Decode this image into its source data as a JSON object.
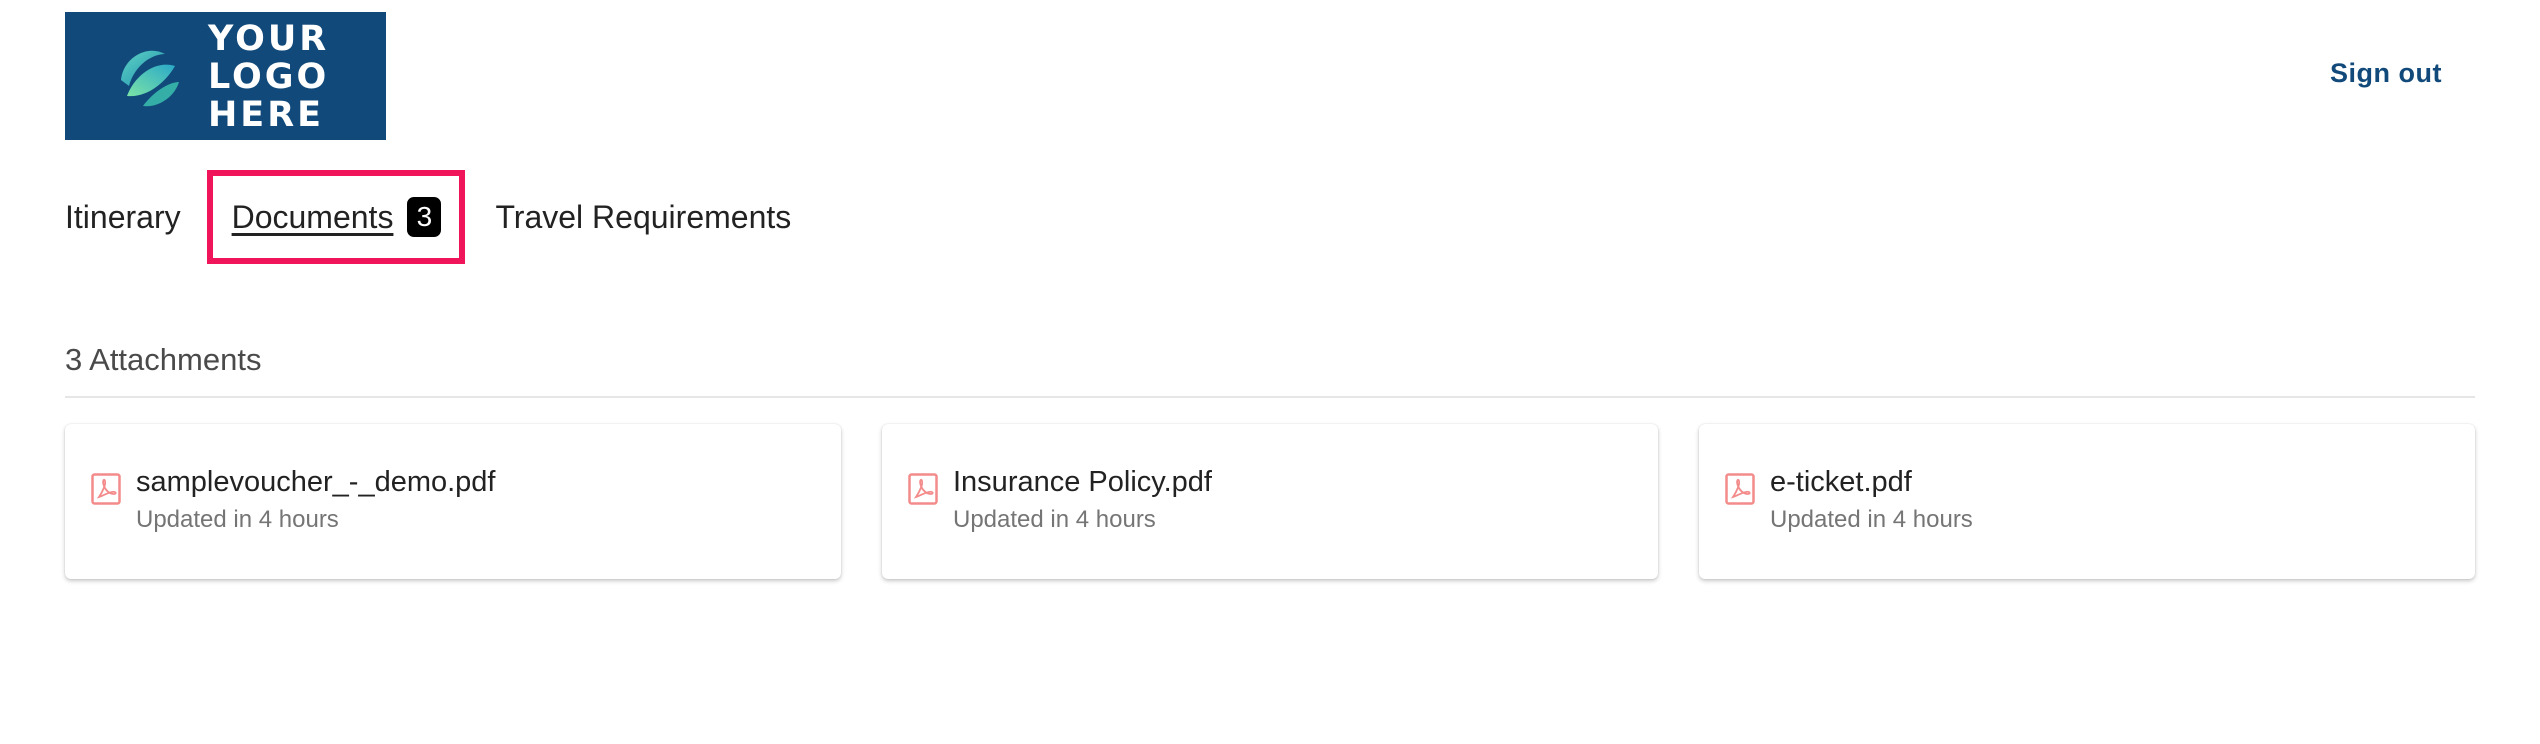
{
  "header": {
    "logo_lines": [
      "YOUR",
      "LOGO",
      "HERE"
    ],
    "logo_bg_color": "#114a7a",
    "sign_out_label": "Sign out"
  },
  "tabs": [
    {
      "label": "Itinerary"
    },
    {
      "label": "Documents",
      "badge": "3",
      "active": true
    },
    {
      "label": "Travel Requirements"
    }
  ],
  "attachments": {
    "title": "3 Attachments",
    "items": [
      {
        "name": "samplevoucher_-_demo.pdf",
        "updated": "Updated in 4 hours",
        "icon": "pdf-icon"
      },
      {
        "name": "Insurance Policy.pdf",
        "updated": "Updated in 4 hours",
        "icon": "pdf-icon"
      },
      {
        "name": "e-ticket.pdf",
        "updated": "Updated in 4 hours",
        "icon": "pdf-icon"
      }
    ]
  },
  "colors": {
    "accent": "#114a7a",
    "highlight": "#f0145a",
    "pdf_icon": "#f48b8b"
  }
}
